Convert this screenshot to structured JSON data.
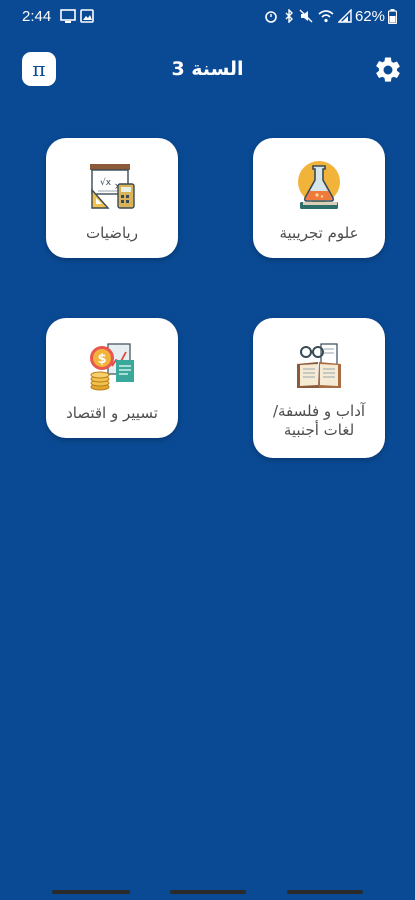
{
  "status_bar": {
    "time": "2:44",
    "battery": "62%"
  },
  "header": {
    "title": "السنة 3",
    "pi_symbol": "π"
  },
  "cards": [
    {
      "label": "علوم تجريبية",
      "icon": "science-flask-icon"
    },
    {
      "label": "رياضيات",
      "icon": "math-board-icon"
    },
    {
      "label": "آداب و فلسفة/ لغات أجنبية",
      "icon": "literature-books-icon"
    },
    {
      "label": "تسيير و اقتصاد",
      "icon": "economics-coins-icon"
    }
  ],
  "colors": {
    "background": "#0a4a94",
    "card": "#ffffff",
    "card_text": "#4d4d4d"
  }
}
